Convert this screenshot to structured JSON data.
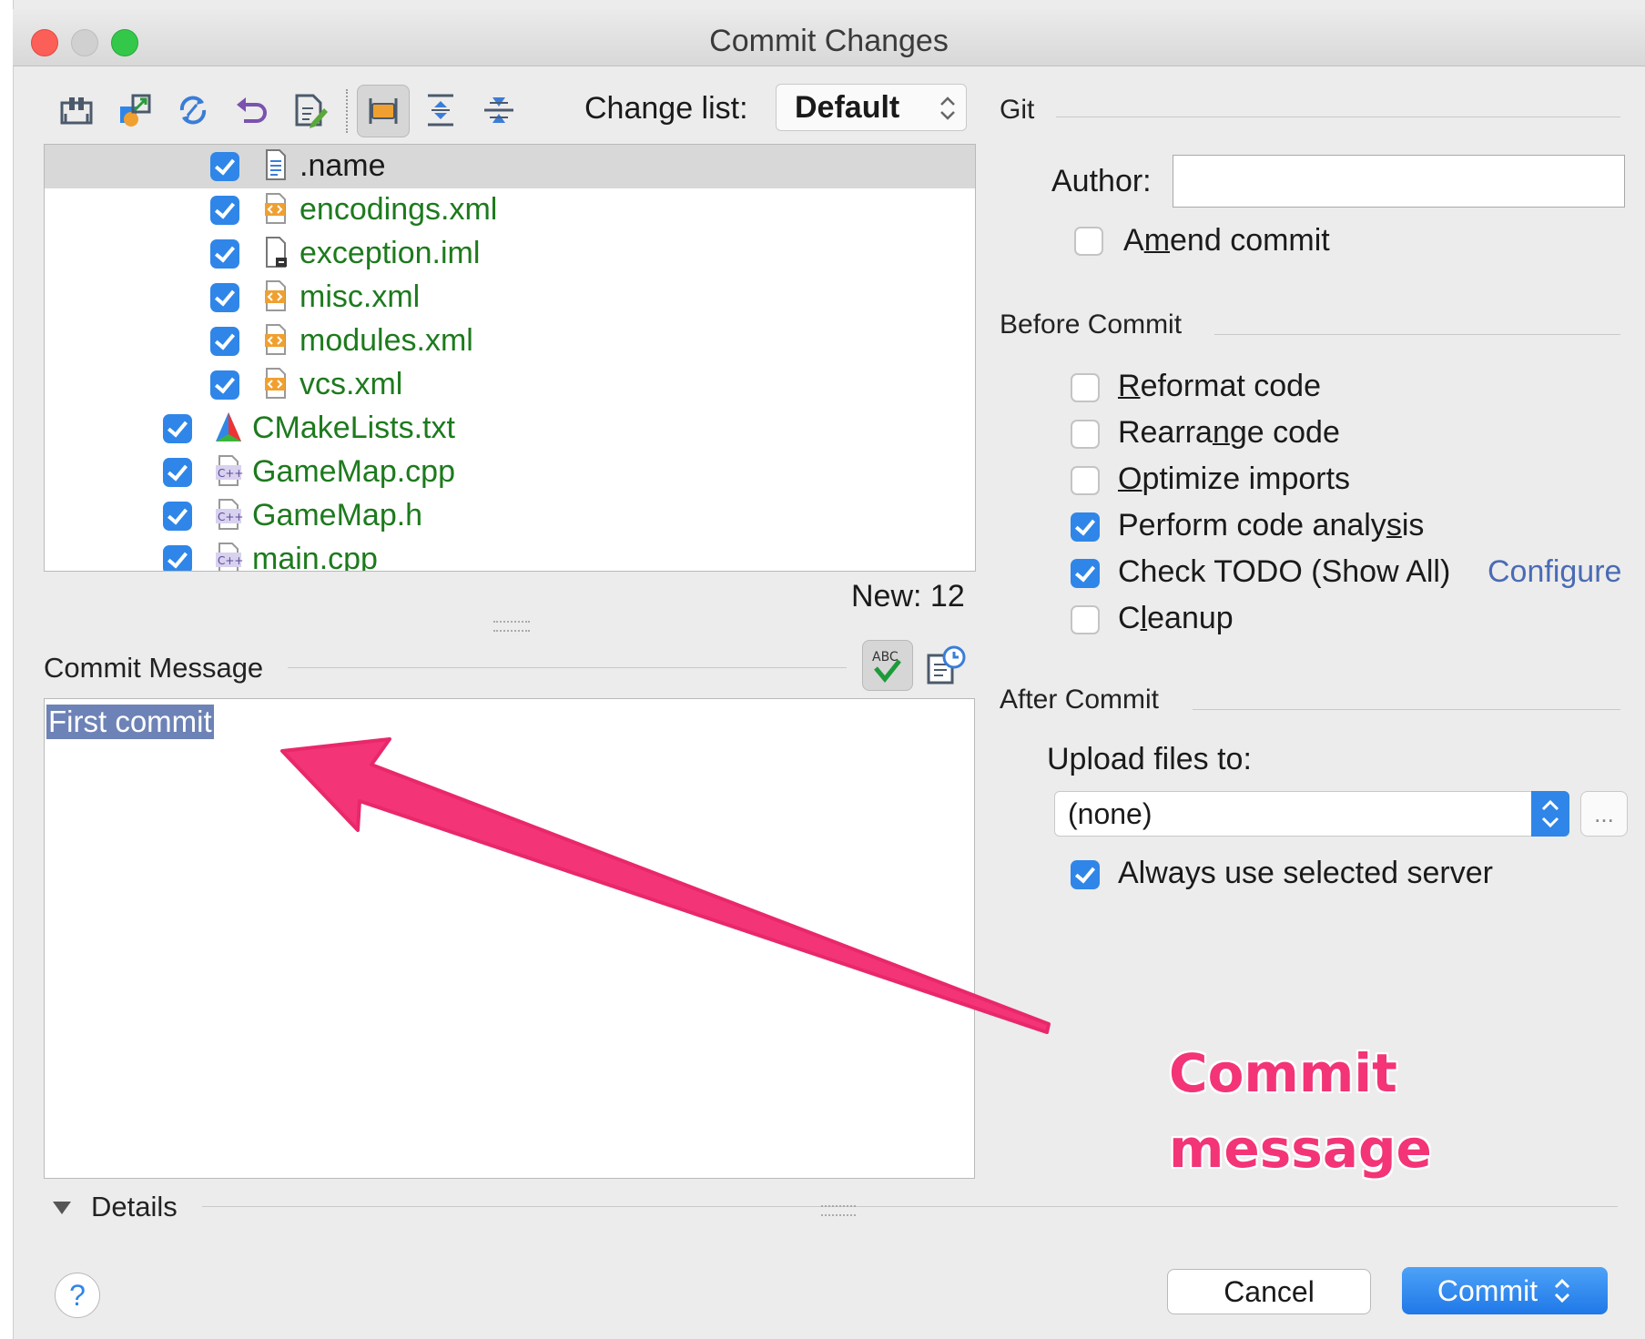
{
  "window": {
    "title": "Commit Changes"
  },
  "toolbar": {
    "icons": [
      "show-diff-icon",
      "move-to-changelist-icon",
      "refresh-icon",
      "revert-icon",
      "edit-source-icon",
      "group-by-directory-icon",
      "expand-all-icon",
      "collapse-all-icon"
    ],
    "changelist_label": "Change list:",
    "changelist_value": "Default"
  },
  "files": [
    {
      "name": ".name",
      "icon": "text-file-icon",
      "color": "#1a1a1a",
      "checked": true,
      "selected": true
    },
    {
      "name": "encodings.xml",
      "icon": "xml-file-icon",
      "color": "#1d7a1d",
      "checked": true
    },
    {
      "name": "exception.iml",
      "icon": "iml-file-icon",
      "color": "#1d7a1d",
      "checked": true
    },
    {
      "name": "misc.xml",
      "icon": "xml-file-icon",
      "color": "#1d7a1d",
      "checked": true
    },
    {
      "name": "modules.xml",
      "icon": "xml-file-icon",
      "color": "#1d7a1d",
      "checked": true
    },
    {
      "name": "vcs.xml",
      "icon": "xml-file-icon",
      "color": "#1d7a1d",
      "checked": true
    },
    {
      "name": "CMakeLists.txt",
      "icon": "cmake-icon",
      "color": "#1d7a1d",
      "checked": true
    },
    {
      "name": "GameMap.cpp",
      "icon": "cpp-file-icon",
      "color": "#1d7a1d",
      "checked": true
    },
    {
      "name": "GameMap.h",
      "icon": "cpp-file-icon",
      "color": "#1d7a1d",
      "checked": true
    },
    {
      "name": "main.cpp",
      "icon": "cpp-file-icon",
      "color": "#1d7a1d",
      "checked": true
    }
  ],
  "status": {
    "new_count": "New: 12"
  },
  "commit_message": {
    "label": "Commit Message",
    "value": "First commit"
  },
  "details": {
    "label": "Details"
  },
  "git": {
    "header": "Git",
    "author_label": "Author:",
    "author_value": "",
    "amend_label": "Amend commit"
  },
  "before_commit": {
    "header": "Before Commit",
    "options": [
      {
        "label": "Reformat code",
        "checked": false
      },
      {
        "label": "Rearrange code",
        "checked": false
      },
      {
        "label": "Optimize imports",
        "checked": false
      },
      {
        "label": "Perform code analysis",
        "checked": true
      },
      {
        "label": "Check TODO (Show All)",
        "checked": true
      },
      {
        "label": "Cleanup",
        "checked": false
      }
    ],
    "configure_link": "Configure"
  },
  "after_commit": {
    "header": "After Commit",
    "upload_label": "Upload files to:",
    "upload_value": "(none)",
    "browse_label": "...",
    "always_use_label": "Always use selected server",
    "always_use_checked": true
  },
  "buttons": {
    "help": "?",
    "cancel": "Cancel",
    "commit": "Commit"
  },
  "annotation": {
    "line1": "Commit",
    "line2": "message",
    "color": "#f33477"
  },
  "colors": {
    "accent": "#2f86e8",
    "new_file": "#1d7a1d",
    "link": "#4a6bb5",
    "selection": "#6d82b6"
  }
}
